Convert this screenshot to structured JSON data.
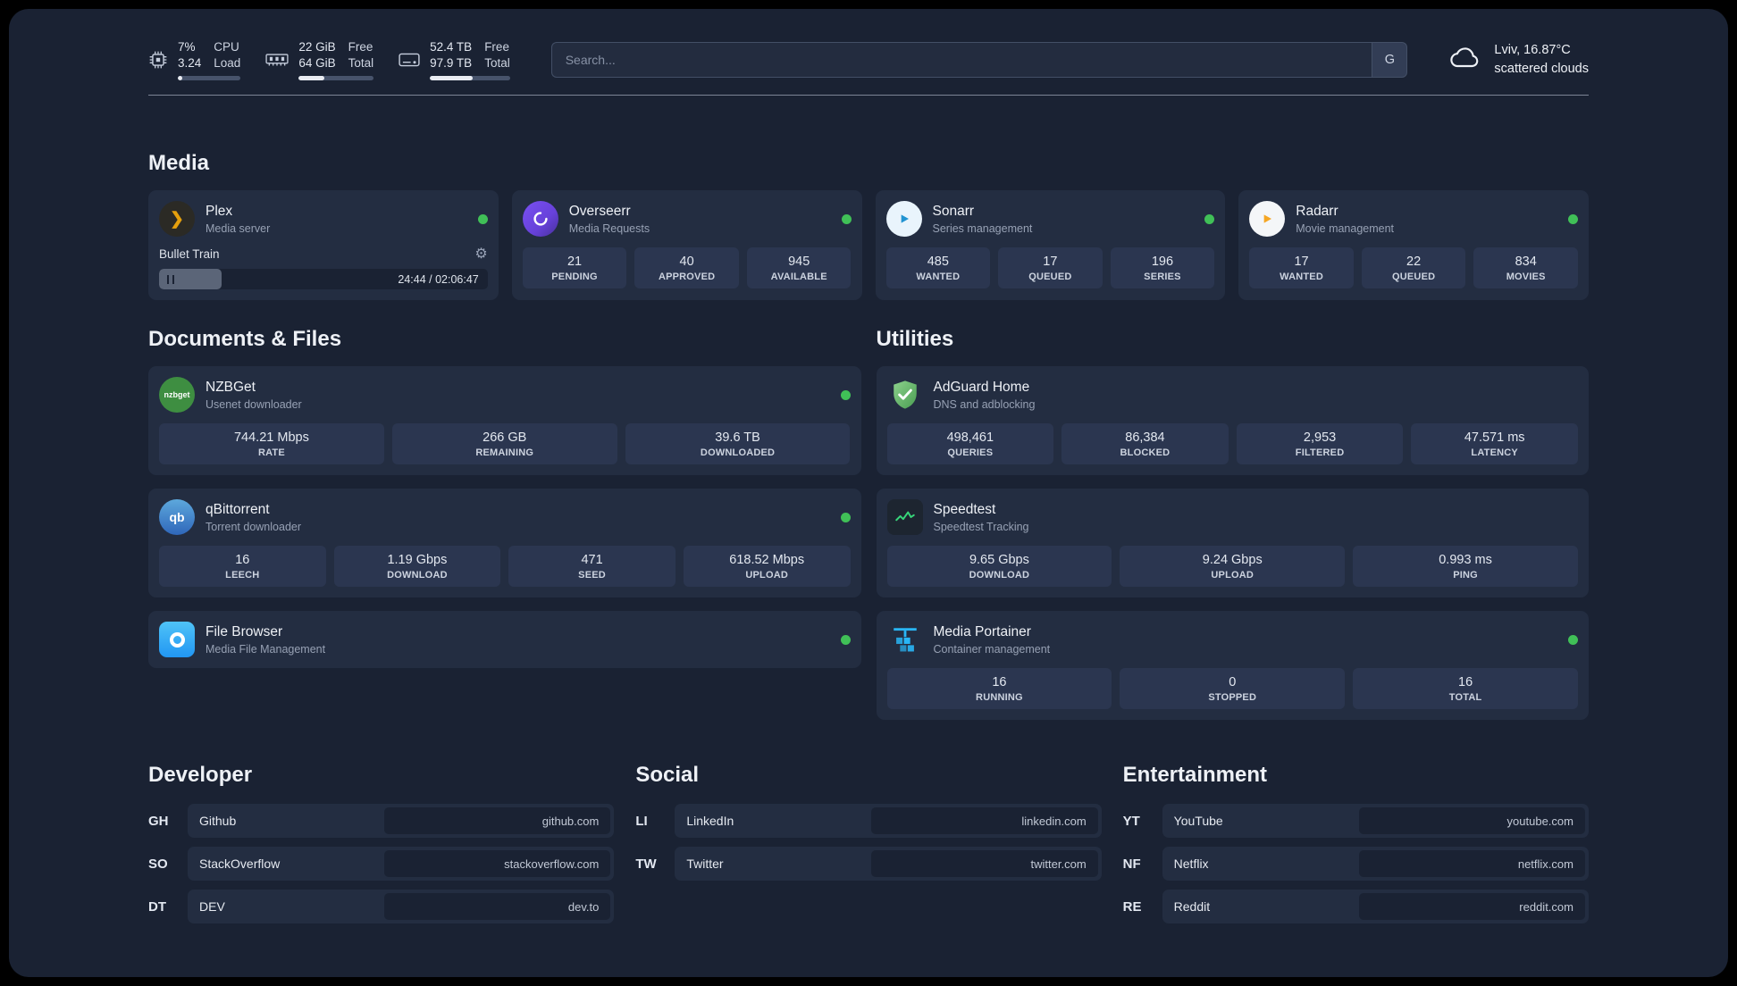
{
  "theme": {
    "bg": "#1a2233",
    "card": "#232d41",
    "stat": "#2b3650",
    "status-green": "#40c057",
    "plex": "#e5a00d",
    "overseerr": "#6741d9",
    "sonarr": "#2193d1",
    "radarr": "#f5a623",
    "nzbget": "#3e8e41",
    "qbittorrent": "#2f67ba",
    "filebrowser": "#2196f3",
    "adguard": "#67b279",
    "speedtest": "#37d67a",
    "portainer": "#29b6f6"
  },
  "topbar": {
    "cpu": {
      "percent": "7%",
      "load": "3.24",
      "label_top": "CPU",
      "label_bottom": "Load",
      "bar_percent": 7
    },
    "ram": {
      "free": "22 GiB",
      "total": "64 GiB",
      "label_top": "Free",
      "label_bottom": "Total",
      "bar_percent": 34
    },
    "disk": {
      "free": "52.4 TB",
      "total": "97.9 TB",
      "label_top": "Free",
      "label_bottom": "Total",
      "bar_percent": 53
    },
    "search": {
      "placeholder": "Search...",
      "button_label": "G"
    },
    "weather": {
      "location": "Lviv, 16.87°C",
      "condition": "scattered clouds"
    }
  },
  "media": {
    "title": "Media",
    "cards": [
      {
        "name": "Plex",
        "desc": "Media server",
        "player": {
          "track": "Bullet Train",
          "time": "24:44 / 02:06:47",
          "progress_percent": 19
        }
      },
      {
        "name": "Overseerr",
        "desc": "Media Requests",
        "stats": [
          {
            "value": "21",
            "label": "PENDING"
          },
          {
            "value": "40",
            "label": "APPROVED"
          },
          {
            "value": "945",
            "label": "AVAILABLE"
          }
        ]
      },
      {
        "name": "Sonarr",
        "desc": "Series management",
        "stats": [
          {
            "value": "485",
            "label": "WANTED"
          },
          {
            "value": "17",
            "label": "QUEUED"
          },
          {
            "value": "196",
            "label": "SERIES"
          }
        ]
      },
      {
        "name": "Radarr",
        "desc": "Movie management",
        "stats": [
          {
            "value": "17",
            "label": "WANTED"
          },
          {
            "value": "22",
            "label": "QUEUED"
          },
          {
            "value": "834",
            "label": "MOVIES"
          }
        ]
      }
    ]
  },
  "documents": {
    "title": "Documents & Files",
    "cards": [
      {
        "name": "NZBGet",
        "desc": "Usenet downloader",
        "icon_text": "nzbget",
        "stats": [
          {
            "value": "744.21 Mbps",
            "label": "RATE"
          },
          {
            "value": "266 GB",
            "label": "REMAINING"
          },
          {
            "value": "39.6 TB",
            "label": "DOWNLOADED"
          }
        ]
      },
      {
        "name": "qBittorrent",
        "desc": "Torrent downloader",
        "icon_text": "qb",
        "stats": [
          {
            "value": "16",
            "label": "LEECH"
          },
          {
            "value": "1.19 Gbps",
            "label": "DOWNLOAD"
          },
          {
            "value": "471",
            "label": "SEED"
          },
          {
            "value": "618.52 Mbps",
            "label": "UPLOAD"
          }
        ]
      },
      {
        "name": "File Browser",
        "desc": "Media File Management",
        "stats": []
      }
    ]
  },
  "utilities": {
    "title": "Utilities",
    "cards": [
      {
        "name": "AdGuard Home",
        "desc": "DNS and adblocking",
        "stats": [
          {
            "value": "498,461",
            "label": "QUERIES"
          },
          {
            "value": "86,384",
            "label": "BLOCKED"
          },
          {
            "value": "2,953",
            "label": "FILTERED"
          },
          {
            "value": "47.571 ms",
            "label": "LATENCY"
          }
        ]
      },
      {
        "name": "Speedtest",
        "desc": "Speedtest Tracking",
        "stats": [
          {
            "value": "9.65 Gbps",
            "label": "DOWNLOAD"
          },
          {
            "value": "9.24 Gbps",
            "label": "UPLOAD"
          },
          {
            "value": "0.993 ms",
            "label": "PING"
          }
        ]
      },
      {
        "name": "Media Portainer",
        "desc": "Container management",
        "stats": [
          {
            "value": "16",
            "label": "RUNNING"
          },
          {
            "value": "0",
            "label": "STOPPED"
          },
          {
            "value": "16",
            "label": "TOTAL"
          }
        ]
      }
    ]
  },
  "bookmarks": [
    {
      "title": "Developer",
      "items": [
        {
          "abbr": "GH",
          "name": "Github",
          "url": "github.com"
        },
        {
          "abbr": "SO",
          "name": "StackOverflow",
          "url": "stackoverflow.com"
        },
        {
          "abbr": "DT",
          "name": "DEV",
          "url": "dev.to"
        }
      ]
    },
    {
      "title": "Social",
      "items": [
        {
          "abbr": "LI",
          "name": "LinkedIn",
          "url": "linkedin.com"
        },
        {
          "abbr": "TW",
          "name": "Twitter",
          "url": "twitter.com"
        }
      ]
    },
    {
      "title": "Entertainment",
      "items": [
        {
          "abbr": "YT",
          "name": "YouTube",
          "url": "youtube.com"
        },
        {
          "abbr": "NF",
          "name": "Netflix",
          "url": "netflix.com"
        },
        {
          "abbr": "RE",
          "name": "Reddit",
          "url": "reddit.com"
        }
      ]
    }
  ]
}
